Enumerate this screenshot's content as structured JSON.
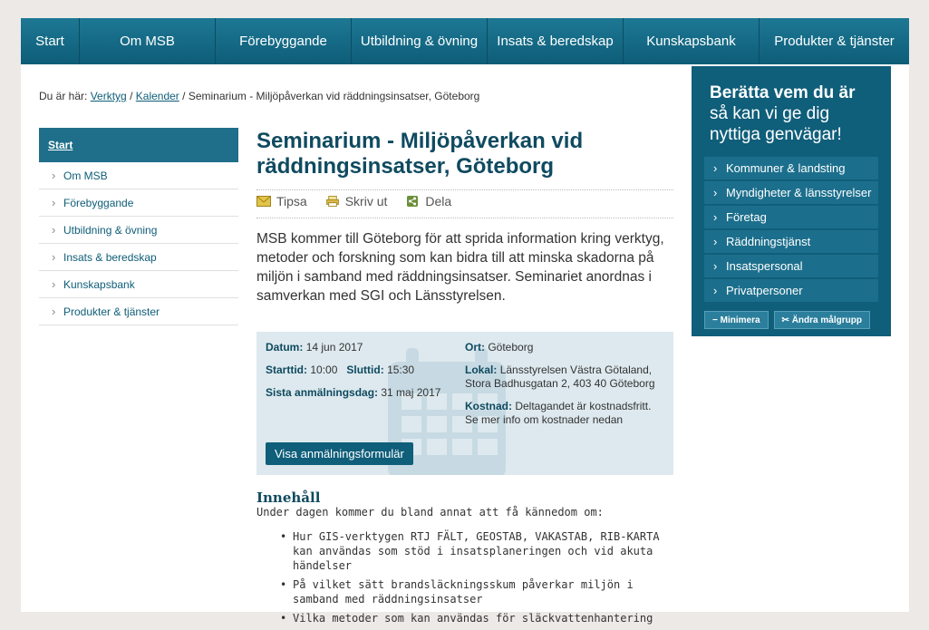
{
  "nav": [
    {
      "label": "Start"
    },
    {
      "label": "Om MSB"
    },
    {
      "label": "Förebyggande"
    },
    {
      "label": "Utbildning & övning"
    },
    {
      "label": "Insats & beredskap"
    },
    {
      "label": "Kunskapsbank"
    },
    {
      "label": "Produkter & tjänster"
    }
  ],
  "breadcrumb": {
    "prefix": "Du är här:",
    "links": [
      "Verktyg",
      "Kalender"
    ],
    "separator": "/",
    "current": "Seminarium - Miljöpåverkan vid räddningsinsatser, Göteborg"
  },
  "leftmenu": {
    "start": "Start",
    "items": [
      "Om MSB",
      "Förebyggande",
      "Utbildning & övning",
      "Insats & beredskap",
      "Kunskapsbank",
      "Produkter & tjänster"
    ]
  },
  "article": {
    "title": "Seminarium - Miljöpåverkan vid räddningsinsatser, Göteborg",
    "tools": {
      "tipsa": "Tipsa",
      "print": "Skriv ut",
      "share": "Dela"
    },
    "intro": "MSB kommer till Göteborg för att sprida information kring verktyg, metoder och forskning som kan bidra till att minska skadorna på miljön i samband med räddningsinsatser. Seminariet anordnas i samverkan med SGI och Länsstyrelsen."
  },
  "info": {
    "datum_label": "Datum:",
    "datum": "14 jun 2017",
    "start_label": "Starttid:",
    "start": "10:00",
    "end_label": "Sluttid:",
    "end": "15:30",
    "deadline_label": "Sista anmälningsdag:",
    "deadline": "31 maj 2017",
    "ort_label": "Ort:",
    "ort": "Göteborg",
    "lokal_label": "Lokal:",
    "lokal": "Länsstyrelsen Västra Götaland, Stora Badhusgatan 2, 403 40 Göteborg",
    "kostnad_label": "Kostnad:",
    "kostnad": "Deltagandet är kostnadsfritt. Se mer info om kostnader nedan",
    "button": "Visa anmälningsformulär"
  },
  "content": {
    "heading": "Innehåll",
    "sub": "Under dagen kommer du bland annat att få kännedom om:",
    "bullets": [
      "Hur GIS-verktygen RTJ FÄLT, GEOSTAB, VAKASTAB, RIB-KARTA kan användas som stöd i insatsplaneringen och vid akuta händelser",
      "På vilket sätt brandsläckningsskum påverkar miljön i samband med räddningsinsatser",
      "Vilka metoder som kan användas för släckvattenhantering"
    ]
  },
  "sidebox": {
    "title_bold": "Berätta vem du är",
    "title_rest": "så kan vi ge dig nyttiga genvägar!",
    "items": [
      "Kommuner & landsting",
      "Myndigheter & länsstyrelser",
      "Företag",
      "Räddningstjänst",
      "Insatspersonal",
      "Privatpersoner"
    ],
    "minimize": "Minimera",
    "change": "Ändra målgrupp"
  },
  "colors": {
    "brand": "#0f5e7a",
    "title": "#0f4a60",
    "infobox": "#dde9ee"
  }
}
